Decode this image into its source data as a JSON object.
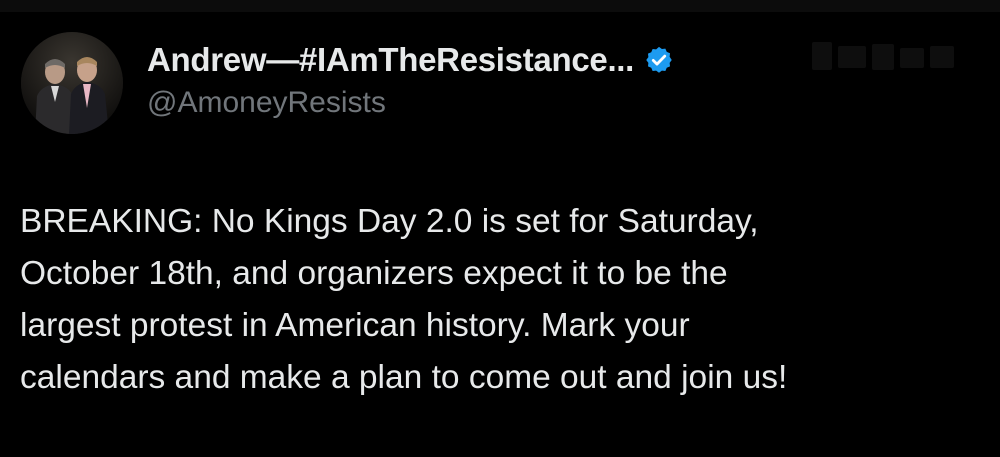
{
  "author": {
    "display_name": "Andrew—#IAmTheResistance...",
    "handle": "@AmoneyResists",
    "verified": true,
    "verified_color": "#1d9bf0"
  },
  "tweet": {
    "text": "BREAKING: No Kings Day 2.0 is set for Saturday,\nOctober 18th, and organizers expect it to be the\nlargest protest in American history. Mark your\ncalendars and make a plan to come out and join us!"
  },
  "icons": {
    "verified": "verified-badge-icon"
  },
  "colors": {
    "background": "#000000",
    "text": "#e7e9ea",
    "secondary_text": "#71767b"
  }
}
